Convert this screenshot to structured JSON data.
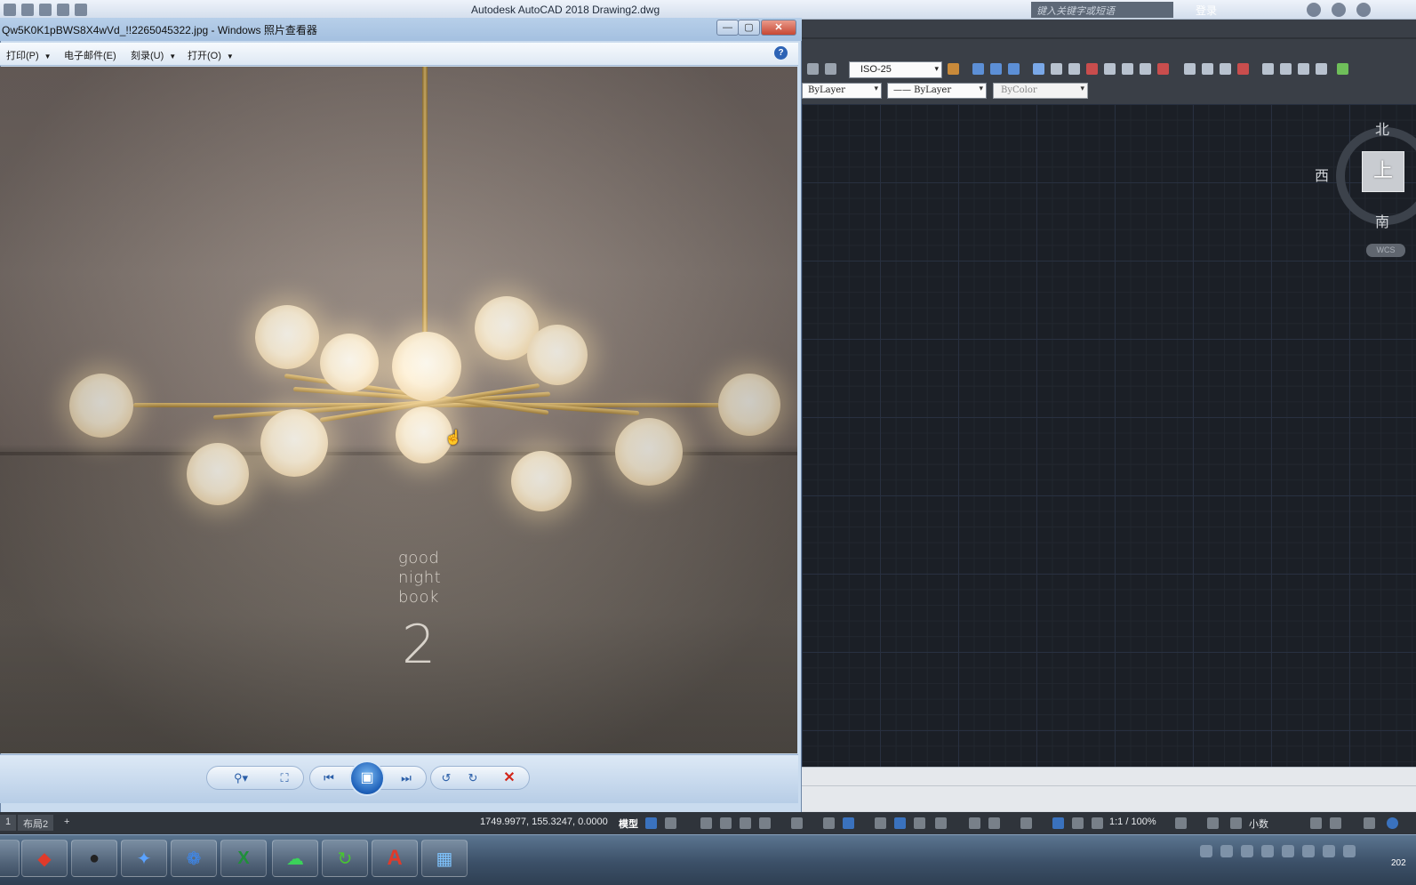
{
  "autocad": {
    "title": "Autodesk AutoCAD 2018    Drawing2.dwg",
    "search_placeholder": "键入关键字或短语",
    "login_label": "登录",
    "dim_style": "ISO-25",
    "layer_color": "ByLayer",
    "linetype": "—— ByLayer",
    "plot_color": "ByColor",
    "viewcube": {
      "north": "北",
      "south": "南",
      "west": "西",
      "face": "上",
      "wcs": "WCS"
    },
    "layout_tabs": [
      "1",
      "布局2",
      "+"
    ],
    "status": {
      "coords": "1749.9977, 155.3247, 0.0000",
      "model": "模型",
      "scale": "1:1 / 100%",
      "units": "小数"
    },
    "colors": {
      "drawing_bg": "#1b1f26",
      "grid": "#283040",
      "ribbon_bg": "#3a3f47"
    }
  },
  "viewer": {
    "title": "Qw5K0K1pBWS8X4wVd_!!2265045322.jpg - Windows 照片查看器",
    "menu": [
      {
        "label": "打印(P)",
        "has_arrow": true
      },
      {
        "label": "电子邮件(E)",
        "has_arrow": false
      },
      {
        "label": "刻录(U)",
        "has_arrow": true
      },
      {
        "label": "打开(O)",
        "has_arrow": true
      }
    ],
    "help_label": "?",
    "window_buttons": {
      "minimize": "—",
      "maximize": "▢",
      "close": "✕"
    },
    "photo": {
      "caption_lines": [
        "good",
        "night",
        "book"
      ],
      "number": "2"
    },
    "controls": {
      "zoom": "⚲▾",
      "fit": "⛶",
      "prev": "⏮",
      "slideshow": "▣",
      "next": "⏭",
      "rotate_ccw": "↺",
      "rotate_cw": "↻",
      "delete": "✕"
    }
  },
  "taskbar": {
    "apps": [
      {
        "name": "folder-app",
        "glyph": "▮"
      },
      {
        "name": "autocad-red-app",
        "glyph": "◆"
      },
      {
        "name": "qq-app",
        "glyph": "●"
      },
      {
        "name": "feather-app",
        "glyph": "✦"
      },
      {
        "name": "cloud-app",
        "glyph": "❁"
      },
      {
        "name": "excel-app",
        "glyph": "X"
      },
      {
        "name": "wechat-app",
        "glyph": "☁"
      },
      {
        "name": "green-refresh-app",
        "glyph": "↻"
      },
      {
        "name": "autocad-app",
        "glyph": "A"
      },
      {
        "name": "photo-viewer-app",
        "glyph": "▦"
      }
    ],
    "clock": "202"
  }
}
